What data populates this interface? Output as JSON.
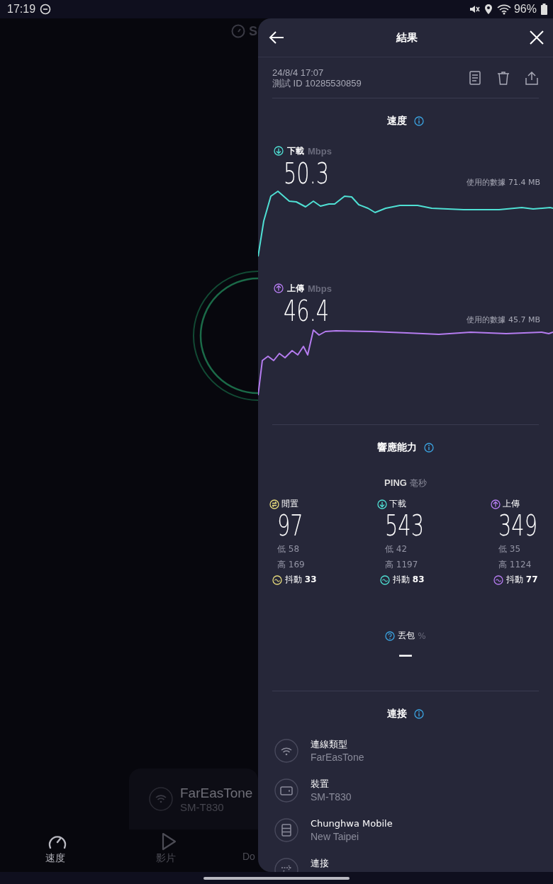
{
  "status_bar": {
    "time": "17:19",
    "battery": "96%"
  },
  "background_app": {
    "logo": "S",
    "connection_card": {
      "provider": "FarEasTone",
      "device": "SM-T830"
    },
    "nav": [
      {
        "label": "速度",
        "kind": "gauge",
        "selected": true
      },
      {
        "label": "影片",
        "kind": "play",
        "selected": false
      },
      {
        "label": "Do",
        "kind": "text",
        "selected": false
      }
    ]
  },
  "panel": {
    "title": "結果",
    "timestamp": "24/8/4 17:07",
    "test_id": "測試 ID 10285530859",
    "speed": {
      "heading": "速度",
      "tests": [
        {
          "kind": "download",
          "label": "下載",
          "unit": "Mbps",
          "value": "50.3",
          "data_used": "使用的數據 71.4 MB",
          "color": "#4fe0d4"
        },
        {
          "kind": "upload",
          "label": "上傳",
          "unit": "Mbps",
          "value": "46.4",
          "data_used": "使用的數據 45.7 MB",
          "color": "#b57cf0"
        }
      ]
    },
    "responsiveness": {
      "heading": "響應能力",
      "ping_label": "PING",
      "ping_unit": "毫秒",
      "columns": [
        {
          "kind": "idle",
          "label": "閒置",
          "value": "97",
          "low": "低 58",
          "high": "高 169",
          "jitter": "抖動 **33**",
          "color": "#e6da7c"
        },
        {
          "kind": "download",
          "label": "下載",
          "value": "543",
          "low": "低 42",
          "high": "高 1197",
          "jitter": "抖動 **83**",
          "color": "#4fe0d4"
        },
        {
          "kind": "upload",
          "label": "上傳",
          "value": "349",
          "low": "低 35",
          "high": "高 1124",
          "jitter": "抖動 **77**",
          "color": "#b57cf0"
        }
      ],
      "packet_loss": {
        "label": "丟包",
        "unit": "%",
        "value": "—"
      }
    },
    "connection": {
      "heading": "連接",
      "items": [
        {
          "kind": "wifi",
          "title": "連線類型",
          "subtitle": "FarEasTone"
        },
        {
          "kind": "tablet",
          "title": "裝置",
          "subtitle": "SM-T830"
        },
        {
          "kind": "server",
          "title": "Chunghwa Mobile",
          "subtitle": "New Taipei"
        },
        {
          "kind": "arrows",
          "title": "連接"
        }
      ]
    }
  }
}
